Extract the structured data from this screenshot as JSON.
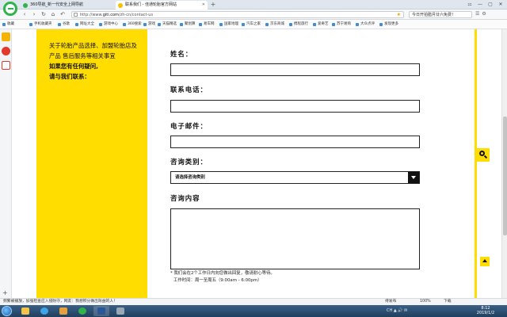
{
  "browser": {
    "tabs": [
      {
        "title": "360导航_新一代安全上网导航",
        "active": false
      },
      {
        "title": "联系我们 - 佳通轮胎官方网站",
        "active": true
      }
    ],
    "new_tab": "+",
    "window_controls": [
      "⚏",
      "—",
      "▢",
      "✕"
    ],
    "url_prefix": "http://www.",
    "url_domain": "giti.com",
    "url_path": "/zh-cn/contact-us",
    "search_box": "今日开拍腊月廿六免费！"
  },
  "bookmarks": [
    "收藏",
    "手机收藏夹",
    "谷歌",
    "网址大全",
    "游戏中心",
    "360搜索",
    "游戏",
    "天猫精选",
    "聚划算",
    "易车网",
    "国家地理",
    "汽车之家",
    "京东商城",
    "携程旅行",
    "爱奇艺",
    "苏宁易购",
    "大众点评",
    "发现更多"
  ],
  "sidebar_panel": {
    "line1": "关于轮胎产品选择、加盟轮胎店及产品 售后服务等相关事宜",
    "line2": "如果您有任何疑问,",
    "line3": "请与我们联系："
  },
  "form": {
    "name_label": "姓名：",
    "phone_label": "联系电话：",
    "email_label": "电子邮件：",
    "category_label": "咨询类别：",
    "category_value": "请选择咨询类别",
    "content_label": "咨询内容",
    "note_line1": "* 我们会在2个工作日内向您做出回复，敬请耐心等待。",
    "note_line2": "工作时间：周一至周五（9:00am - 6:00pm）"
  },
  "statusbar": {
    "left": "频繁被播放，加强检查应入侵防守，网友：我想积分做出效益的人！",
    "items": [
      "待发布",
      "100%",
      "下载"
    ]
  },
  "taskbar": {
    "tray_text": "CH ▲ 🔊 ✉",
    "time": "8:12",
    "date": "2019/1/2"
  },
  "colors": {
    "brand_yellow": "#ffdd00",
    "browser_green": "#2fb34a"
  }
}
